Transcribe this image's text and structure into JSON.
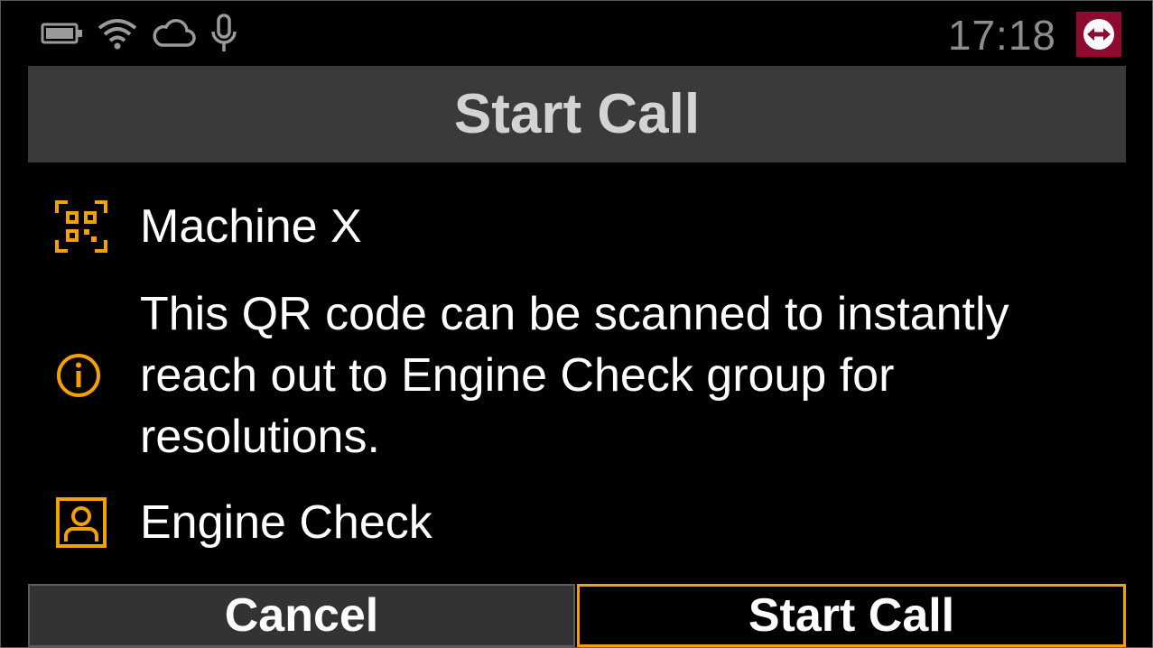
{
  "status_bar": {
    "icons": [
      "battery-icon",
      "wifi-icon",
      "cloud-icon",
      "microphone-icon"
    ],
    "time": "17:18",
    "app_logo": "teamviewer-logo-icon"
  },
  "title_bar": {
    "title": "Start Call"
  },
  "details": {
    "machine": {
      "icon": "qr-code-icon",
      "label": "Machine X"
    },
    "info": {
      "icon": "info-icon",
      "text": "This QR code can be scanned to instantly reach out to Engine Check group for resolutions."
    },
    "contact": {
      "icon": "contact-icon",
      "label": "Engine Check"
    }
  },
  "buttons": {
    "cancel_label": "Cancel",
    "start_call_label": "Start Call"
  },
  "colors": {
    "accent": "#f4a100",
    "title_bar_bg": "#3a3a3a",
    "logo_bg": "#8c0b2e",
    "clock": "#8d8d8d"
  }
}
